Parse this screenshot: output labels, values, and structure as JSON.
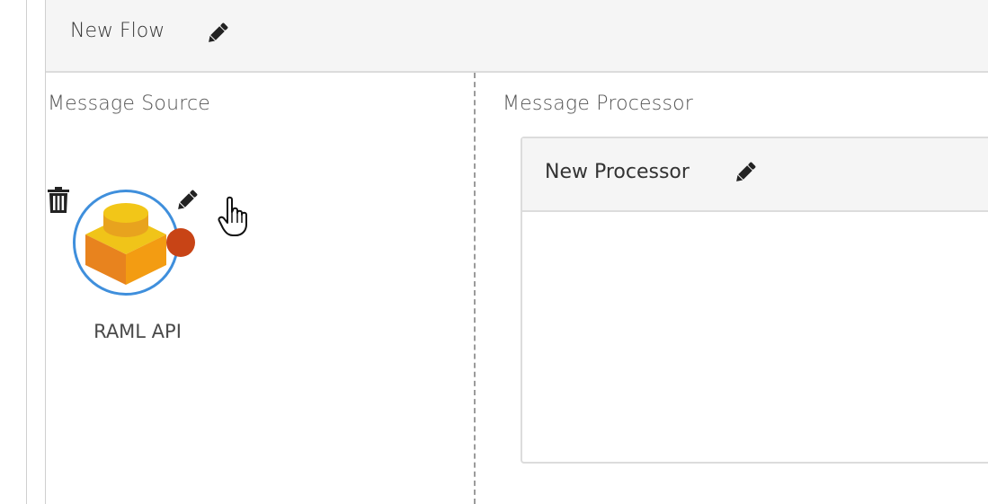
{
  "flow": {
    "title": "New Flow",
    "edit_icon": "pencil-icon"
  },
  "source_section": {
    "label": "Message Source",
    "component": {
      "name": "RAML API",
      "icon": "lego-block-icon",
      "status_color": "#c84416",
      "ring_color": "#3f8fdc",
      "delete_icon": "trash-icon",
      "edit_icon": "pencil-icon"
    }
  },
  "processor_section": {
    "label": "Message Processor",
    "processor": {
      "title": "New Processor",
      "edit_icon": "pencil-icon"
    }
  }
}
